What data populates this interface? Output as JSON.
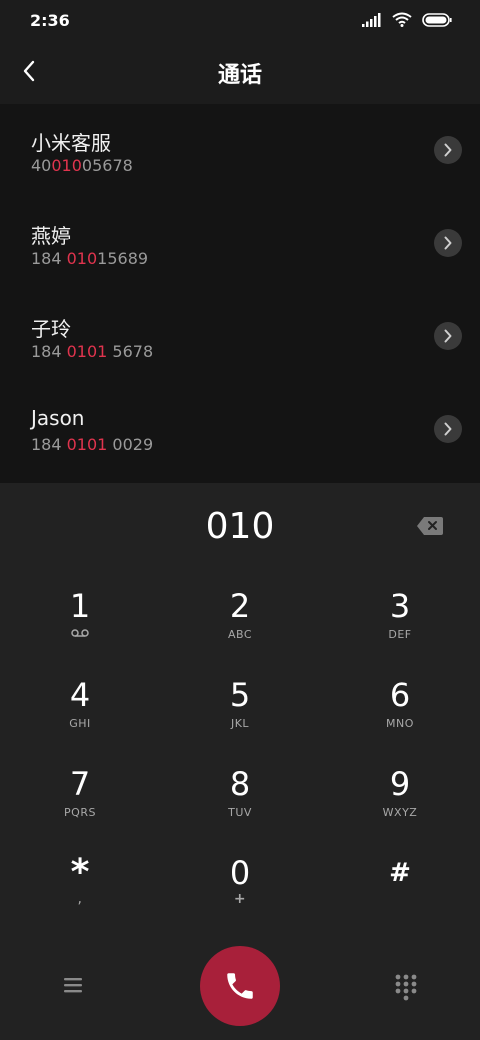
{
  "status": {
    "time": "2:36"
  },
  "header": {
    "title": "通话"
  },
  "results": [
    {
      "name": "小米客服",
      "number_before": "40",
      "number_match": "010",
      "number_after": "05678"
    },
    {
      "name": "燕婷",
      "number_before": "184 ",
      "number_match": "010",
      "number_after": "15689"
    },
    {
      "name": "子玲",
      "number_before": "184 ",
      "number_match": "0101",
      "number_after": " 5678"
    },
    {
      "name": "Jason",
      "number_before": "184 ",
      "number_match": "0101",
      "number_after": " 0029"
    }
  ],
  "dialer": {
    "input": "010",
    "keys": [
      {
        "digit": "1",
        "letters": ""
      },
      {
        "digit": "2",
        "letters": "ABC"
      },
      {
        "digit": "3",
        "letters": "DEF"
      },
      {
        "digit": "4",
        "letters": "GHI"
      },
      {
        "digit": "5",
        "letters": "JKL"
      },
      {
        "digit": "6",
        "letters": "MNO"
      },
      {
        "digit": "7",
        "letters": "PQRS"
      },
      {
        "digit": "8",
        "letters": "TUV"
      },
      {
        "digit": "9",
        "letters": "WXYZ"
      },
      {
        "digit": "*",
        "letters": ","
      },
      {
        "digit": "0",
        "letters": "+"
      },
      {
        "digit": "#",
        "letters": ""
      }
    ]
  },
  "icons": {
    "key1_sub": "voicemail-icon",
    "back": "back-arrow-icon",
    "backspace": "backspace-icon",
    "menu": "menu-icon",
    "call": "phone-icon",
    "keypad": "keypad-icon"
  },
  "colors": {
    "accent": "#e0344e",
    "call_button": "#a8203a",
    "results_bg": "#141414",
    "dialer_bg": "#222222"
  }
}
